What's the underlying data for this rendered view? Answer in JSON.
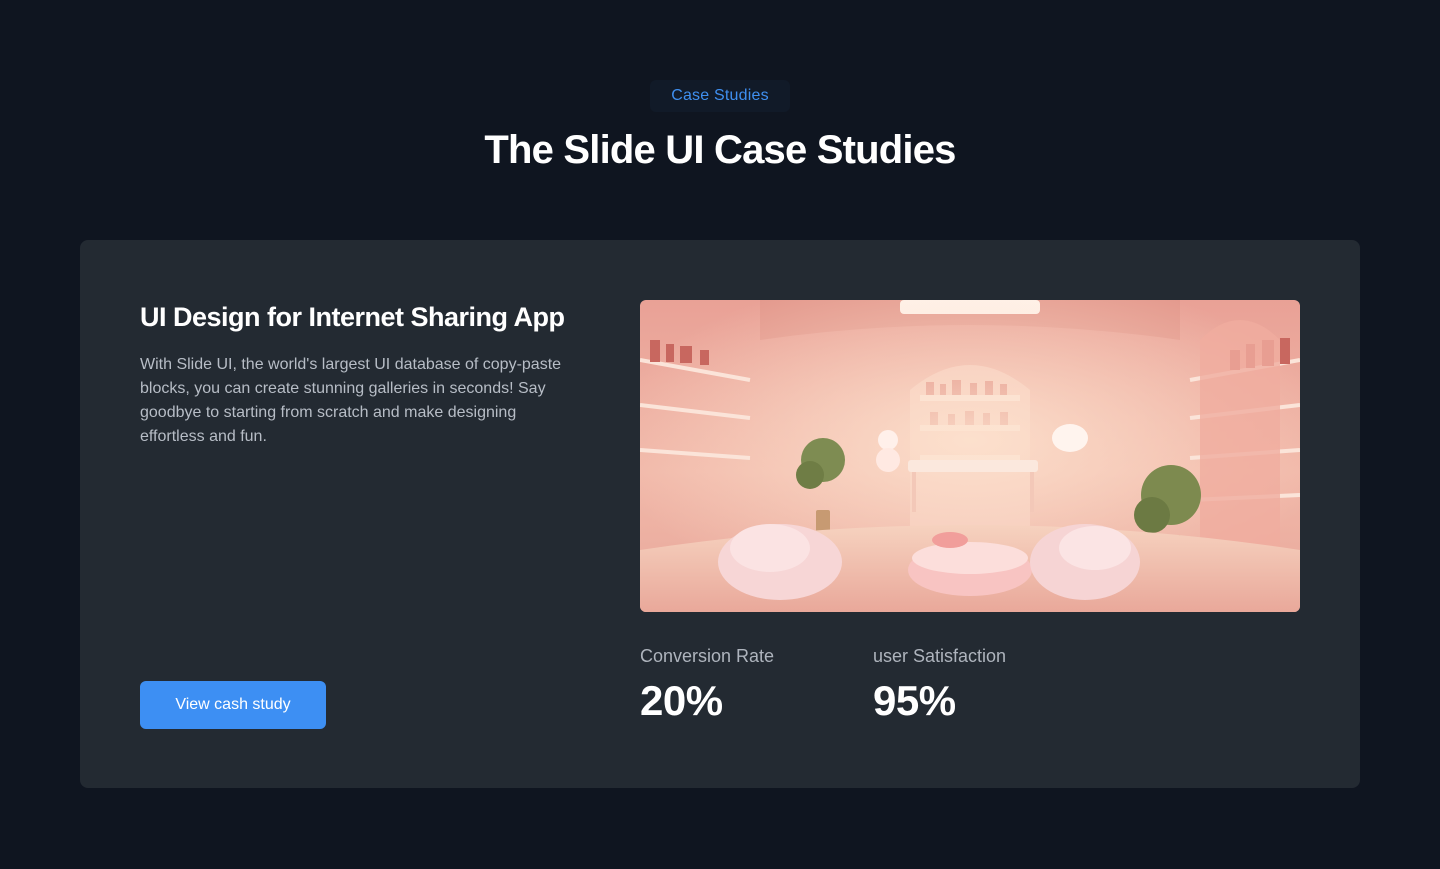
{
  "section": {
    "eyebrow": "Case Studies",
    "title": "The Slide UI Case Studies"
  },
  "case_study": {
    "title": "UI Design for Internet Sharing App",
    "description": "With Slide UI, the world's largest UI database of copy-paste blocks, you can create stunning galleries in seconds! Say goodbye to starting from scratch and make designing effortless and fun.",
    "cta_label": "View cash study",
    "stats": [
      {
        "label": "Conversion Rate",
        "value": "20%"
      },
      {
        "label": "user Satisfaction",
        "value": "95%"
      }
    ]
  },
  "colors": {
    "background": "#0f1520",
    "card": "#232a32",
    "accent": "#3d8ff3",
    "eyebrow_text": "#3f8ff0"
  }
}
